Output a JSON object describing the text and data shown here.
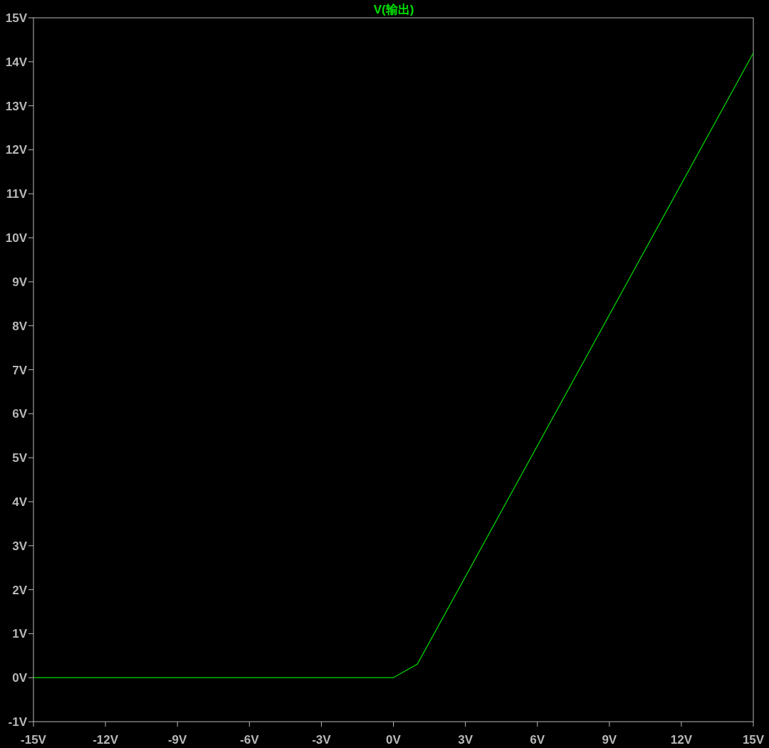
{
  "chart_data": {
    "type": "line",
    "x": [
      -15,
      0,
      1,
      15
    ],
    "series": [
      {
        "name": "V(输出)",
        "color": "#00e000",
        "values": [
          0,
          0,
          0.31,
          14.2
        ]
      }
    ],
    "xlim": [
      -15,
      15
    ],
    "ylim": [
      -1,
      15
    ],
    "xticks": [
      {
        "value": -15,
        "label": "-15V"
      },
      {
        "value": -12,
        "label": "-12V"
      },
      {
        "value": -9,
        "label": "-9V"
      },
      {
        "value": -6,
        "label": "-6V"
      },
      {
        "value": -3,
        "label": "-3V"
      },
      {
        "value": 0,
        "label": "0V"
      },
      {
        "value": 3,
        "label": "3V"
      },
      {
        "value": 6,
        "label": "6V"
      },
      {
        "value": 9,
        "label": "9V"
      },
      {
        "value": 12,
        "label": "12V"
      },
      {
        "value": 15,
        "label": "15V"
      }
    ],
    "yticks": [
      {
        "value": 15,
        "label": "15V"
      },
      {
        "value": 14,
        "label": "14V"
      },
      {
        "value": 13,
        "label": "13V"
      },
      {
        "value": 12,
        "label": "12V"
      },
      {
        "value": 11,
        "label": "11V"
      },
      {
        "value": 10,
        "label": "10V"
      },
      {
        "value": 9,
        "label": "9V"
      },
      {
        "value": 8,
        "label": "8V"
      },
      {
        "value": 7,
        "label": "7V"
      },
      {
        "value": 6,
        "label": "6V"
      },
      {
        "value": 5,
        "label": "5V"
      },
      {
        "value": 4,
        "label": "4V"
      },
      {
        "value": 3,
        "label": "3V"
      },
      {
        "value": 2,
        "label": "2V"
      },
      {
        "value": 1,
        "label": "1V"
      },
      {
        "value": 0,
        "label": "0V"
      },
      {
        "value": -1,
        "label": "-1V"
      }
    ]
  }
}
